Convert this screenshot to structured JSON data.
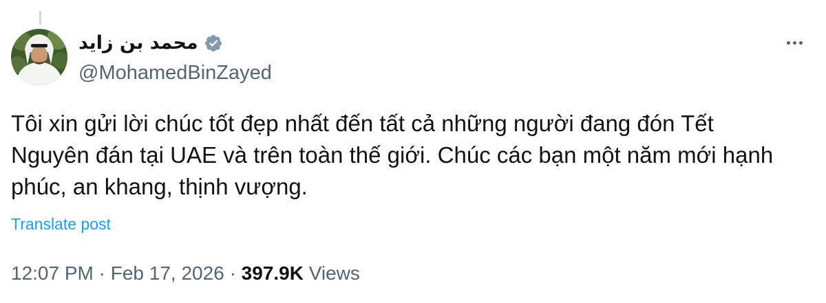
{
  "post": {
    "author": {
      "display_name": "محمد بن زايد",
      "handle": "@MohamedBinZayed",
      "verified_icon": "verified-badge-icon",
      "badge_color": "#829aab"
    },
    "text": "Tôi xin gửi lời chúc tốt đẹp nhất đến tất cả những người đang đón Tết Nguyên đán tại UAE và trên toàn thế giới. Chúc các bạn một năm mới hạnh phúc, an khang, thịnh vượng.",
    "translate_label": "Translate post",
    "time": "12:07 PM",
    "separator": "·",
    "date": "Feb 17, 2026",
    "views_count": "397.9K",
    "views_label": "Views"
  },
  "more_icon": "more-horizontal-icon",
  "colors": {
    "text": "#0f1419",
    "secondary": "#536471",
    "link": "#1d9bf0"
  }
}
